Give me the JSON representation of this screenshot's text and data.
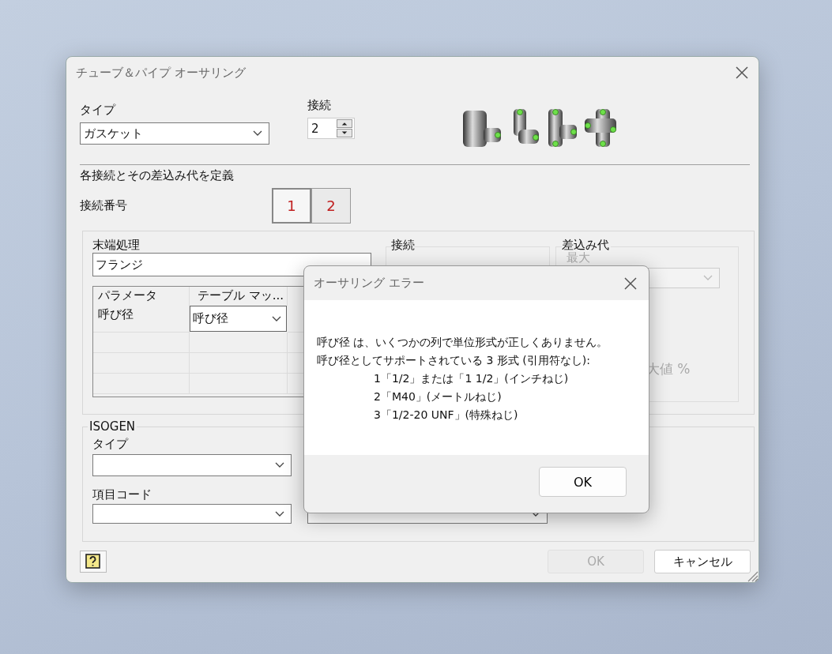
{
  "main_dialog": {
    "title": "チューブ＆パイプ オーサリング",
    "type_label": "タイプ",
    "type_value": "ガスケット",
    "connections_label": "接続",
    "connections_value": "2",
    "section_title": "各接続とその差込み代を定義",
    "connection_number_label": "接続番号",
    "connection_tabs": [
      {
        "label": "1",
        "selected": true
      },
      {
        "label": "2",
        "selected": false
      }
    ],
    "end_treatment": {
      "label": "末端処理",
      "value": "フランジ"
    },
    "connection_group": {
      "label": "接続"
    },
    "engagement": {
      "label": "差込み代",
      "disabled": true,
      "max_label": "最大",
      "max_fragment": "大値 %"
    },
    "table": {
      "columns": [
        "パラメータ",
        "テーブル マッ..."
      ],
      "rows": [
        {
          "parameter": "呼び径",
          "mapping": "呼び径"
        }
      ]
    },
    "isogen": {
      "label": "ISOGEN",
      "type_label": "タイプ",
      "item_code_label": "項目コード"
    },
    "buttons": [
      {
        "label": "OK",
        "disabled": true
      },
      {
        "label": "キャンセル",
        "disabled": false
      }
    ]
  },
  "error_dialog": {
    "title": "オーサリング エラー",
    "lines": [
      "呼び径 は、いくつかの列で単位形式が正しくありません。",
      "呼び径としてサポートされている 3 形式 (引用符なし):"
    ],
    "items": [
      "1「1/2」または「1 1/2」(インチねじ)",
      "2「M40」(メートルねじ)",
      "3「1/2-20 UNF」(特殊ねじ)"
    ],
    "button": "OK"
  }
}
